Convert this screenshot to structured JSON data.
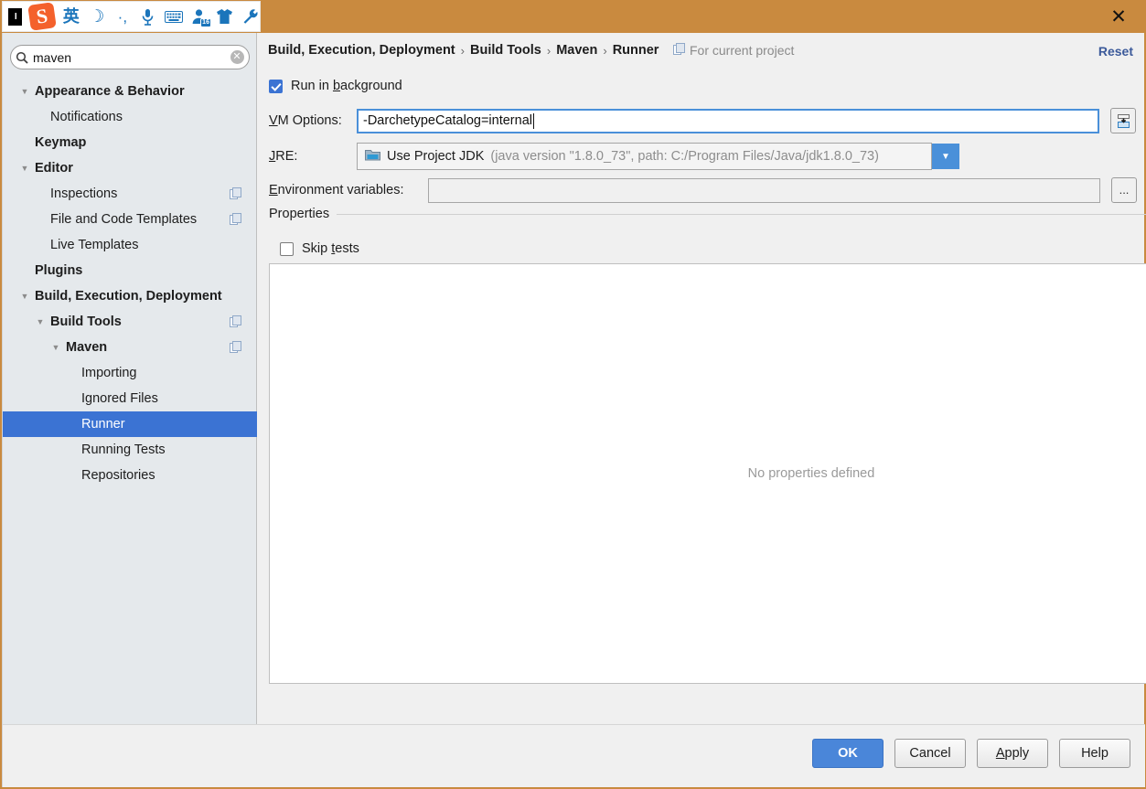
{
  "ime": {
    "logo_label": "I",
    "sogou_letter": "S",
    "icons": [
      {
        "name": "chinese-english-toggle-icon",
        "glyph": "英"
      },
      {
        "name": "moon-icon",
        "glyph": "☽"
      },
      {
        "name": "comma-punctuation-icon",
        "glyph": "·,"
      },
      {
        "name": "microphone-icon",
        "glyph": "🎤"
      },
      {
        "name": "soft-keyboard-icon",
        "glyph": "⌨"
      },
      {
        "name": "user-center-icon",
        "glyph": "👤",
        "badge": "16"
      },
      {
        "name": "skin-shirt-icon",
        "glyph": "👕"
      },
      {
        "name": "toolbox-wrench-icon",
        "glyph": "🔧"
      }
    ],
    "close_label": "✕"
  },
  "search": {
    "value": "maven",
    "placeholder": "",
    "clear_label": "✕"
  },
  "sidebar": {
    "items": [
      {
        "label": "Appearance & Behavior",
        "indent": 0,
        "arrow": "▼",
        "bold": true,
        "selected": false,
        "copy": false
      },
      {
        "label": "Notifications",
        "indent": 1,
        "arrow": "",
        "bold": false,
        "selected": false,
        "copy": false
      },
      {
        "label": "Keymap",
        "indent": 0,
        "arrow": "",
        "bold": true,
        "selected": false,
        "copy": false
      },
      {
        "label": "Editor",
        "indent": 0,
        "arrow": "▼",
        "bold": true,
        "selected": false,
        "copy": false
      },
      {
        "label": "Inspections",
        "indent": 1,
        "arrow": "",
        "bold": false,
        "selected": false,
        "copy": true
      },
      {
        "label": "File and Code Templates",
        "indent": 1,
        "arrow": "",
        "bold": false,
        "selected": false,
        "copy": true
      },
      {
        "label": "Live Templates",
        "indent": 1,
        "arrow": "",
        "bold": false,
        "selected": false,
        "copy": false
      },
      {
        "label": "Plugins",
        "indent": 0,
        "arrow": "",
        "bold": true,
        "selected": false,
        "copy": false
      },
      {
        "label": "Build, Execution, Deployment",
        "indent": 0,
        "arrow": "▼",
        "bold": true,
        "selected": false,
        "copy": false
      },
      {
        "label": "Build Tools",
        "indent": 1,
        "arrow": "▼",
        "bold": true,
        "selected": false,
        "copy": true
      },
      {
        "label": "Maven",
        "indent": 2,
        "arrow": "▼",
        "bold": true,
        "selected": false,
        "copy": true
      },
      {
        "label": "Importing",
        "indent": 3,
        "arrow": "",
        "bold": false,
        "selected": false,
        "copy": false
      },
      {
        "label": "Ignored Files",
        "indent": 3,
        "arrow": "",
        "bold": false,
        "selected": false,
        "copy": false
      },
      {
        "label": "Runner",
        "indent": 3,
        "arrow": "",
        "bold": false,
        "selected": true,
        "copy": false
      },
      {
        "label": "Running Tests",
        "indent": 3,
        "arrow": "",
        "bold": false,
        "selected": false,
        "copy": false
      },
      {
        "label": "Repositories",
        "indent": 3,
        "arrow": "",
        "bold": false,
        "selected": false,
        "copy": false
      }
    ]
  },
  "header": {
    "breadcrumb": [
      "Build, Execution, Deployment",
      "Build Tools",
      "Maven",
      "Runner"
    ],
    "separator": "›",
    "scope_label": "For current project",
    "reset_label": "Reset"
  },
  "form": {
    "run_in_background": {
      "label_pre": "Run in ",
      "label_key": "b",
      "label_post": "ackground",
      "checked": true
    },
    "vm_options": {
      "label_key": "V",
      "label_post": "M Options:",
      "value": "-DarchetypeCatalog=internal"
    },
    "vm_expand_button": "expand-editor-icon",
    "jre": {
      "label_key": "J",
      "label_post": "RE:",
      "value": "Use Project JDK",
      "detail": "(java version \"1.8.0_73\", path: C:/Program Files/Java/jdk1.8.0_73)",
      "arrow": "▼"
    },
    "environment_variables": {
      "label_key": "E",
      "label_post": "nvironment variables:",
      "value": "",
      "browse_label": "..."
    },
    "properties_group_title": "Properties",
    "skip_tests": {
      "label_pre": "Skip ",
      "label_key": "t",
      "label_post": "ests",
      "checked": false
    },
    "table_empty_text": "No properties defined",
    "table_buttons": [
      {
        "name": "add-property-button",
        "glyph": "+"
      },
      {
        "name": "remove-property-button",
        "glyph": "−"
      },
      {
        "name": "edit-property-button",
        "glyph": "✎"
      }
    ]
  },
  "footer": {
    "ok": "OK",
    "cancel": "Cancel",
    "apply_pre": "",
    "apply_key": "A",
    "apply_post": "pply",
    "help": "Help"
  },
  "colors": {
    "titlebar": "#c98a3f",
    "accent_blue": "#3b73d3",
    "sidebar_bg": "#e5e9ec",
    "dialog_bg": "#f0f0f0",
    "reset_link": "#3c5a9a"
  }
}
